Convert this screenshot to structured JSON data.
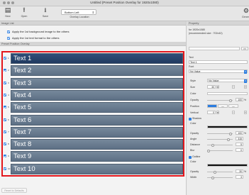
{
  "window": {
    "title": "Untitled  (Preset Position Overlay for 1920x1080)"
  },
  "toolbar": {
    "new_label": "New",
    "open_label": "Open",
    "save_label": "Save",
    "location_value": "Bottom Left",
    "location_label": "Overlay Location",
    "right_label": "Gener"
  },
  "left": {
    "image_list_header": "Image List",
    "apply_bg": "Apply the 1st background image to the others",
    "apply_text": "Apply the 1st text format to the others",
    "overlay_header": "Preset Position Overlay",
    "overlays": [
      {
        "num": "1",
        "text": "Text 1"
      },
      {
        "num": "2",
        "text": "Text 2"
      },
      {
        "num": "3",
        "text": "Text 3"
      },
      {
        "num": "4",
        "text": "Text 4"
      },
      {
        "num": "5",
        "text": "Text 5"
      },
      {
        "num": "6",
        "text": "Text 6"
      },
      {
        "num": "7",
        "text": "Text 7"
      },
      {
        "num": "8",
        "text": "Text 8"
      },
      {
        "num": "9",
        "text": "Text 9"
      },
      {
        "num": "10",
        "text": "Text 10"
      }
    ],
    "reset_label": "Reset to Defaults"
  },
  "property": {
    "header": "Property",
    "for_res": "for 1920x1080",
    "recommended": "(recommended size : 702x42)",
    "next_btn": ">>",
    "text_label": "Text",
    "text_value": "Text 1",
    "font_label": "Font",
    "font_value": "No Value",
    "style_label": "Style",
    "style_value": "No Value",
    "size_label": "Size",
    "size_value": "30",
    "color_label": "Color",
    "opacity_label": "Opacity",
    "opacity_value": "100",
    "opacity_unit": "%",
    "position_label": "Position",
    "vertical_label": "Vertical",
    "vertical_value": "0",
    "shadow_label": "Shadow",
    "shadow_color_label": "Color",
    "shadow_opacity_label": "Opacity",
    "shadow_opacity_value": "100",
    "shadow_opacity_unit": "%",
    "angle_label": "Angle",
    "angle_value": "315",
    "distance_label": "Distance",
    "distance_value": "5",
    "blur_label": "Blur",
    "blur_value": "0",
    "outline_label": "Outline",
    "outline_color_label": "Color",
    "outline_opacity_label": "Opacity",
    "outline_opacity_value": "30",
    "outline_opacity_unit": "%",
    "width_label": "Width",
    "width_value": "3"
  },
  "colors": {
    "accent": "#2b7de1",
    "highlight": "#e3161c",
    "bar": "#5d7085",
    "bar_selected": "#203a60"
  }
}
